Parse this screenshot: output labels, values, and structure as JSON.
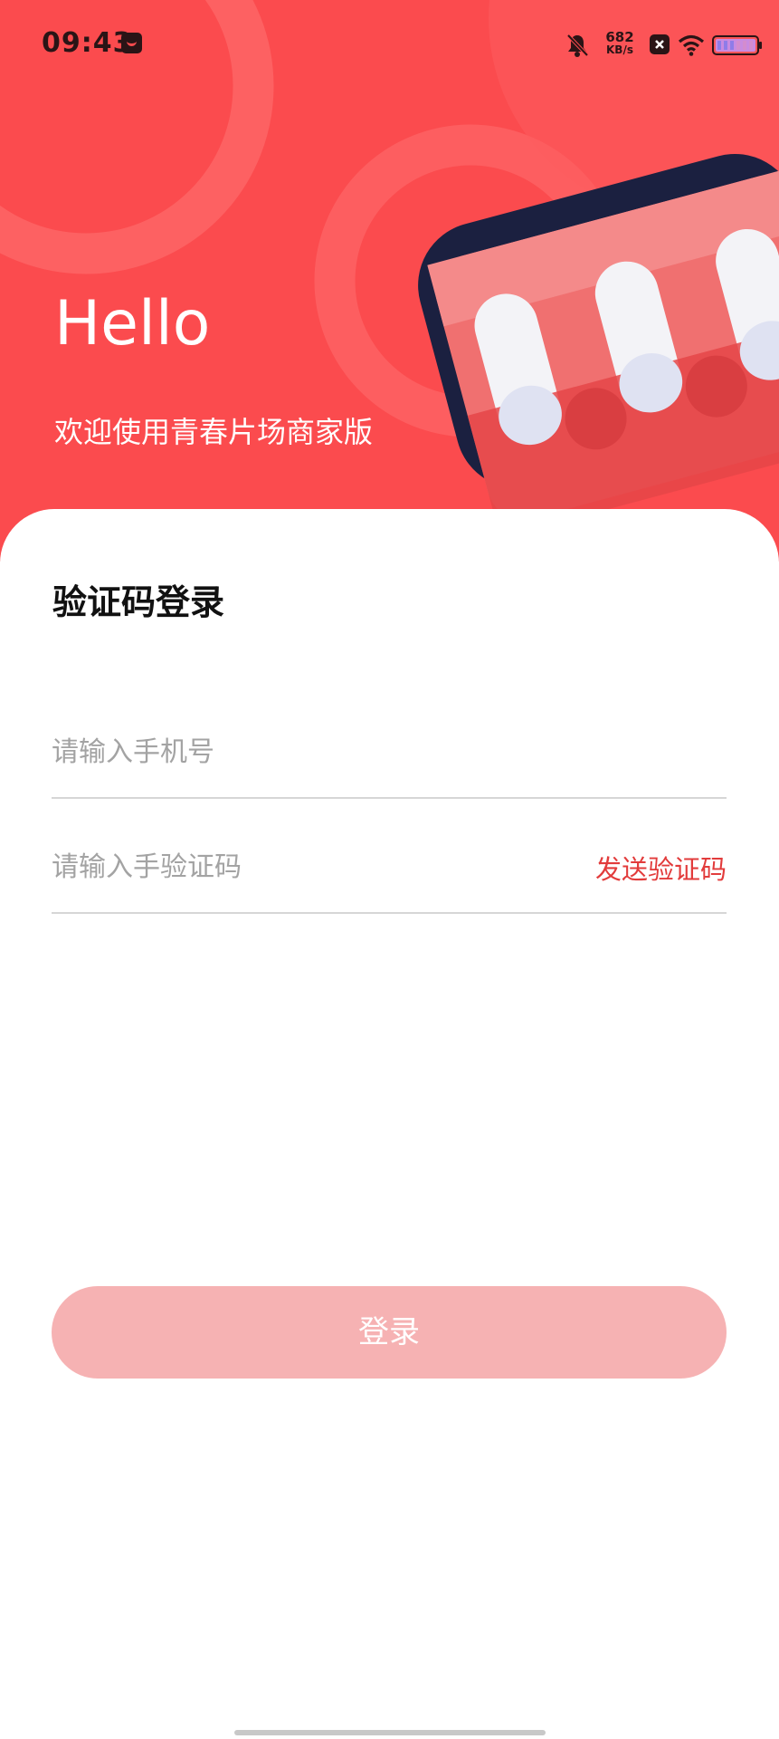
{
  "status_bar": {
    "time": "09:43",
    "network_speed_value": "682",
    "network_speed_unit": "KB/s"
  },
  "hero": {
    "greeting": "Hello",
    "subtitle": "欢迎使用青春片场商家版"
  },
  "form": {
    "title": "验证码登录",
    "phone_placeholder": "请输入手机号",
    "phone_value": "",
    "code_placeholder": "请输入手验证码",
    "code_value": "",
    "send_code_label": "发送验证码",
    "login_label": "登录"
  },
  "colors": {
    "brand_red": "#fb4b4e",
    "link_red": "#e23b3b",
    "button_disabled_pink": "#f6b2b3",
    "awning_navy": "#1b2040"
  },
  "icons": [
    "app-notification-icon",
    "silent-bell-icon",
    "close-box-icon",
    "wifi-icon",
    "battery-icon",
    "store-awning-illustration"
  ]
}
